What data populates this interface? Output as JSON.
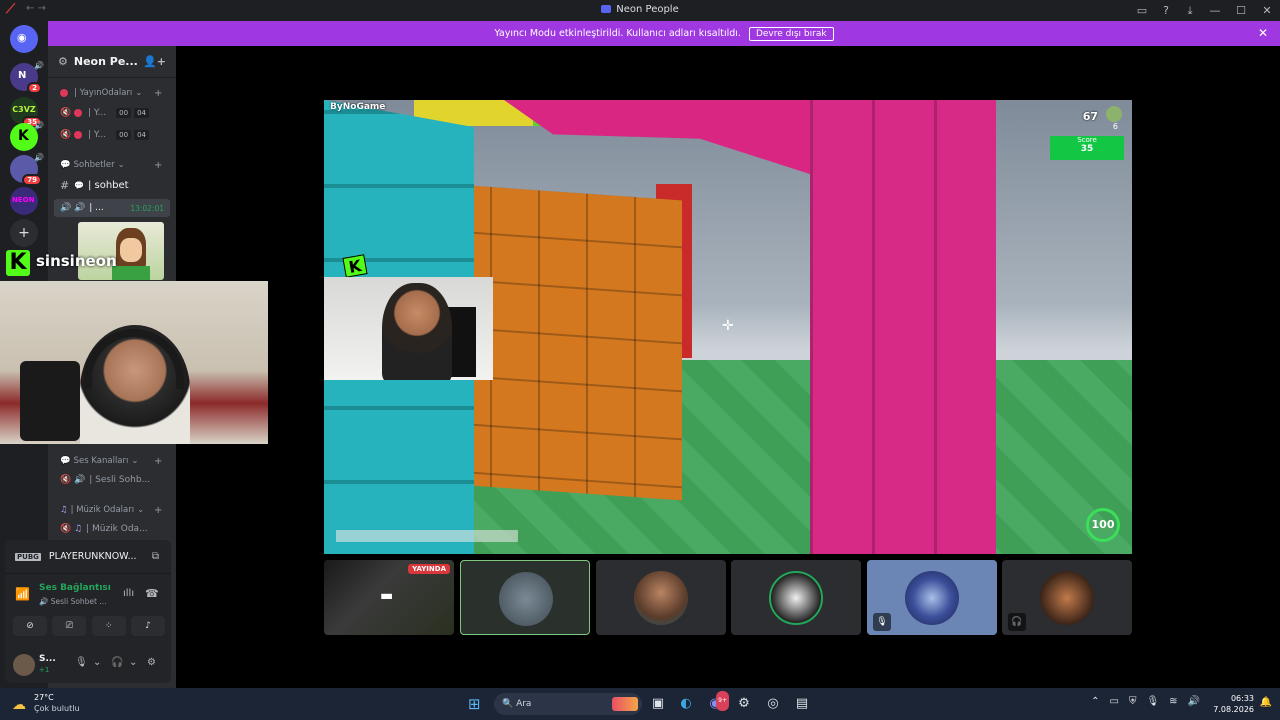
{
  "window": {
    "title": "Neon People",
    "tb_icons": [
      "inbox-icon",
      "help-icon",
      "download-icon"
    ],
    "controls": [
      "—",
      "☐",
      "✕"
    ]
  },
  "banner": {
    "message": "Yayıncı Modu etkinleştirildi. Kullanıcı adları kısaltıldı.",
    "button": "Devre dışı bırak"
  },
  "guilds": [
    {
      "label": "N",
      "badge": "2",
      "color": "#4a3a8a"
    },
    {
      "label": "C3VZ",
      "badge": "35",
      "color": "#1f3a1f"
    },
    {
      "label": "K",
      "badge": "",
      "color": "#53fc18"
    },
    {
      "label": "",
      "badge": "79",
      "color": "#5a5aa8"
    },
    {
      "label": "NEON",
      "badge": "",
      "color": "#3a2a7a"
    }
  ],
  "server": {
    "name": "Neon Pe...",
    "categories": {
      "yayin": "| YayınOdaları",
      "sohbetler": "Sohbetler",
      "ses": "Ses Kanalları",
      "muzik": "| Müzik Odaları"
    },
    "channels": {
      "yayin1": "| Y...",
      "yayin2": "| Y...",
      "pill_a": "00",
      "pill_b": "04",
      "sohbet": "| sohbet",
      "active_voice": "| ...",
      "active_time": "13:02:01",
      "sesli": "| Sesli Sohb...",
      "muzik": "| Müzik Oda..."
    }
  },
  "streamer": {
    "brand_letter": "K",
    "name": "sinsineon"
  },
  "user_panel": {
    "activity": "PLAYERUNKNOW...",
    "activity_badge": "PUBG",
    "voice_title": "Ses Bağlantısı K",
    "voice_sub": "Sesli Sohbet ...",
    "self_name": "S...",
    "self_sub": "+1"
  },
  "game": {
    "logo": "ByNoGame",
    "player_count": "67",
    "player_sub": "6",
    "score_label": "Score",
    "score_value": "35",
    "health": "100",
    "kick_letter": "K"
  },
  "tiles": {
    "live_label": "YAYINDA"
  },
  "taskbar": {
    "temperature": "27°C",
    "weather_desc": "Çok bulutlu",
    "search_placeholder": "Ara",
    "discord_badge": "9+",
    "time": "06:33",
    "date": "7.08.2026"
  }
}
